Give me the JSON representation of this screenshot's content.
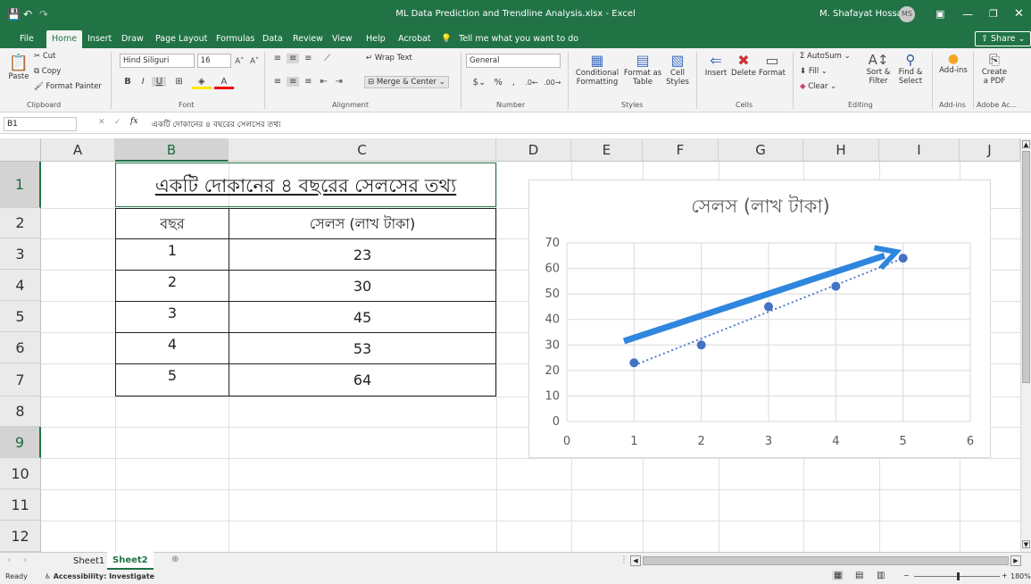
{
  "window": {
    "title": "ML Data Prediction and Trendline Analysis.xlsx  -  Excel",
    "user": "M. Shafayat Hossain",
    "user_initials": "MS"
  },
  "ribbon_tabs": [
    "File",
    "Home",
    "Insert",
    "Draw",
    "Page Layout",
    "Formulas",
    "Data",
    "Review",
    "View",
    "Help",
    "Acrobat"
  ],
  "tell_me": "Tell me what you want to do",
  "share_label": "Share",
  "clipboard": {
    "paste": "Paste",
    "cut": "Cut",
    "copy": "Copy",
    "format_painter": "Format Painter",
    "group": "Clipboard"
  },
  "font": {
    "name": "Hind Siliguri",
    "size": "16",
    "group": "Font"
  },
  "alignment": {
    "wrap": "Wrap Text",
    "merge": "Merge & Center",
    "group": "Alignment"
  },
  "number": {
    "format": "General",
    "group": "Number"
  },
  "styles": {
    "conditional": "Conditional",
    "formatting": "Formatting",
    "format_as": "Format as",
    "table": "Table",
    "cell": "Cell",
    "cell_styles": "Styles",
    "group": "Styles"
  },
  "cells": {
    "insert": "Insert",
    "delete": "Delete",
    "format": "Format",
    "group": "Cells"
  },
  "editing": {
    "autosum": "AutoSum",
    "fill": "Fill",
    "clear": "Clear",
    "sort": "Sort &",
    "filter": "Filter",
    "find": "Find &",
    "select": "Select",
    "group": "Editing"
  },
  "addins": {
    "label": "Add-ins",
    "group": "Add-ins"
  },
  "adobe": {
    "create": "Create",
    "pdf": "a PDF",
    "group": "Adobe Ac..."
  },
  "formula_bar": {
    "name_box": "B1",
    "fx": "fx",
    "content": "একটি দোকানের ৪ বছরের সেলসের তথ্য"
  },
  "columns": [
    "A",
    "B",
    "C",
    "D",
    "E",
    "F",
    "G",
    "H",
    "I",
    "J"
  ],
  "rows": [
    "1",
    "2",
    "3",
    "4",
    "5",
    "6",
    "7",
    "8",
    "9",
    "10",
    "11",
    "12"
  ],
  "sheet": {
    "title": "একটি দোকানের ৪ বছরের সেলসের তথ্য",
    "headers": [
      "বছর",
      "সেলস (লাখ টাকা)"
    ],
    "data": [
      [
        "1",
        "23"
      ],
      [
        "2",
        "30"
      ],
      [
        "3",
        "45"
      ],
      [
        "4",
        "53"
      ],
      [
        "5",
        "64"
      ]
    ]
  },
  "chart_data": {
    "type": "scatter",
    "title": "সেলস (লাখ টাকা)",
    "x": [
      1,
      2,
      3,
      4,
      5
    ],
    "y": [
      23,
      30,
      45,
      53,
      64
    ],
    "xlim": [
      0,
      6
    ],
    "ylim": [
      0,
      70
    ],
    "x_ticks": [
      "0",
      "1",
      "2",
      "3",
      "4",
      "5",
      "6"
    ],
    "y_ticks": [
      "0",
      "10",
      "20",
      "30",
      "40",
      "50",
      "60",
      "70"
    ],
    "trendline": "linear, dotted",
    "grid": true,
    "point_color": "#4472c4",
    "arrow_color": "#2e86de",
    "arrow": {
      "from": [
        0.85,
        31.5
      ],
      "to": [
        4.9,
        66.5
      ]
    }
  },
  "sheet_tabs": [
    "Sheet1",
    "Sheet2"
  ],
  "active_sheet": "Sheet2",
  "status": {
    "ready": "Ready",
    "accessibility": "Accessibility: Investigate",
    "zoom": "180%"
  }
}
